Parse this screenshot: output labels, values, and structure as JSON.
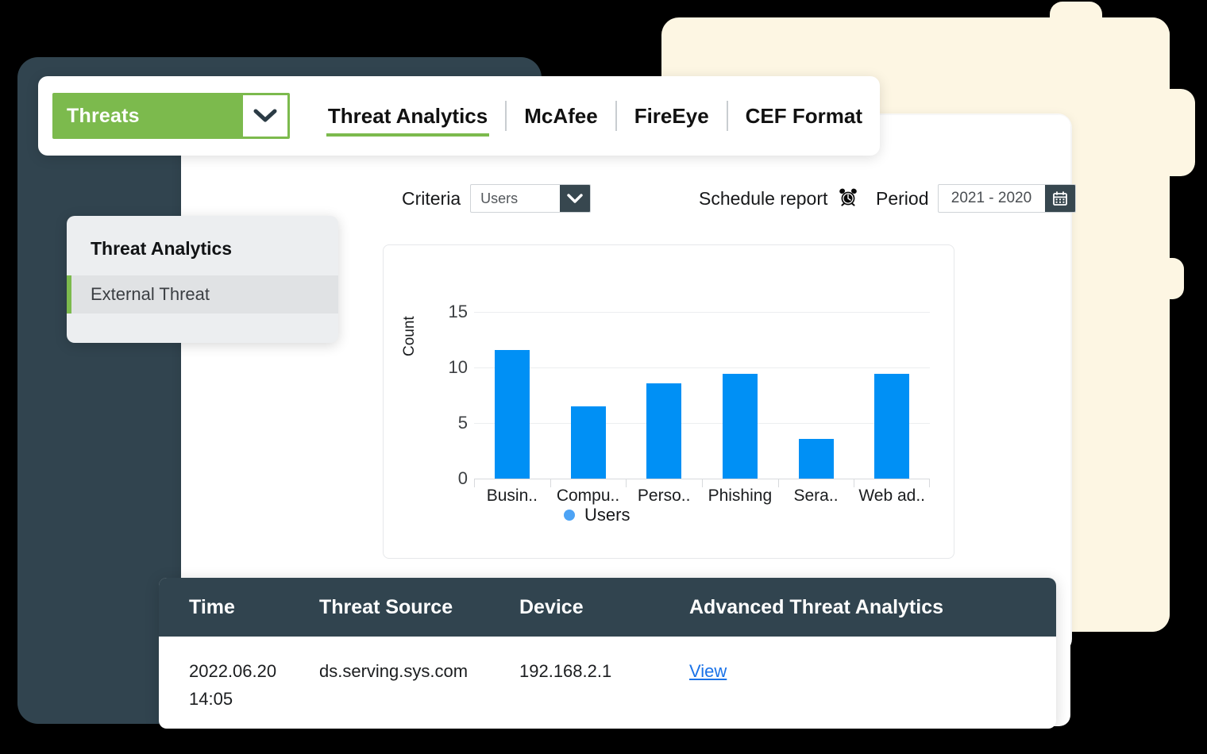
{
  "topbar": {
    "module_select": {
      "value": "Threats",
      "icon": "chevron-down-icon"
    },
    "tabs": [
      {
        "label": "Threat Analytics",
        "active": true
      },
      {
        "label": "McAfee",
        "active": false
      },
      {
        "label": "FireEye",
        "active": false
      },
      {
        "label": "CEF Format",
        "active": false
      }
    ]
  },
  "toolbar": {
    "criteria_label": "Criteria",
    "criteria_value": "Users",
    "criteria_icon": "chevron-down-icon",
    "schedule_label": "Schedule report",
    "schedule_icon": "alarm-clock-icon",
    "period_label": "Period",
    "period_value": "2021 - 2020",
    "period_icon": "calendar-icon"
  },
  "side_menu": {
    "title": "Threat Analytics",
    "item_label": "External Threat"
  },
  "chart_data": {
    "type": "bar",
    "title": "",
    "xlabel": "",
    "ylabel": "Count",
    "categories": [
      "Busin..",
      "Compu..",
      "Perso..",
      "Phishing",
      "Sera..",
      "Web ad.."
    ],
    "values": [
      11.6,
      6.5,
      8.6,
      9.4,
      3.6,
      9.4
    ],
    "ylim": [
      0,
      15
    ],
    "yticks": [
      0,
      5,
      10,
      15
    ],
    "grid": true,
    "legend": {
      "position": "bottom-right",
      "entries": [
        "Users"
      ]
    },
    "series": [
      {
        "name": "Users",
        "color": "#0090f5",
        "values": [
          11.6,
          6.5,
          8.6,
          9.4,
          3.6,
          9.4
        ]
      }
    ]
  },
  "table": {
    "columns": [
      "Time",
      "Threat Source",
      "Device",
      "Advanced Threat Analytics"
    ],
    "rows": [
      {
        "time": "2022.06.20 14:05",
        "source": "ds.serving.sys.com",
        "device": "192.168.2.1",
        "action": "View"
      }
    ]
  },
  "colors": {
    "accent_green": "#7cba4d",
    "navy": "#31444f",
    "bar_blue": "#0090f5",
    "legend_blue": "#4da3f5",
    "link_blue": "#1b73e8",
    "cream": "#fdf6e3"
  }
}
